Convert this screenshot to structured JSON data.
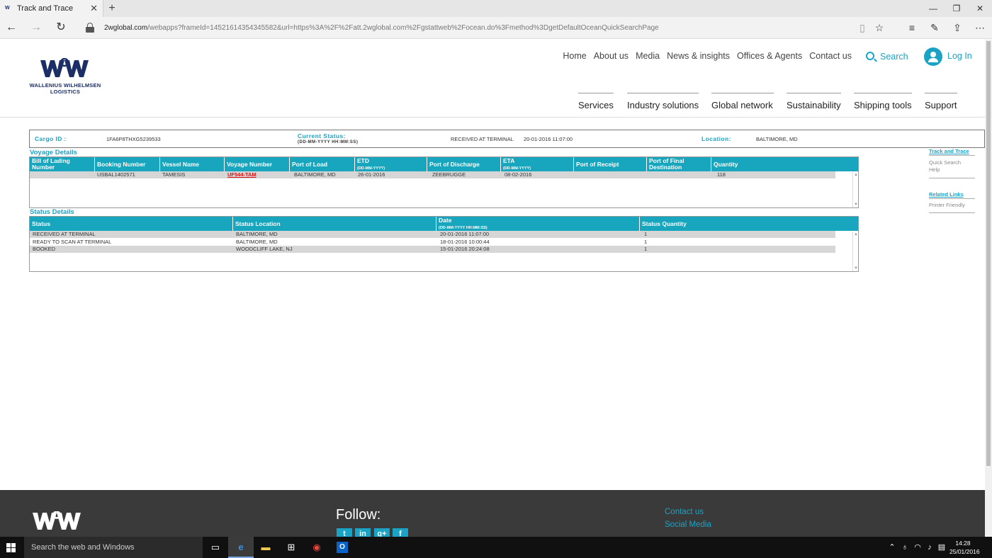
{
  "browser": {
    "tab_title": "Track and Trace",
    "new_tab": "+",
    "url_domain": "2wglobal.com",
    "url_path": "/webapps?frameId=14521614354345582&url=https%3A%2F%2Fatt.2wglobal.com%2Fgstattweb%2Focean.do%3Fmethod%3DgetDefaultOceanQuickSearchPage",
    "icons": [
      "back-icon",
      "forward-icon",
      "refresh-icon",
      "lock-icon",
      "reading-view-icon",
      "favorite-star-icon",
      "hub-icon",
      "web-note-icon",
      "share-icon",
      "more-icon"
    ]
  },
  "site": {
    "logo_text_line1": "WALLENIUS WILHELMSEN",
    "logo_text_line2": "LOGISTICS",
    "top_nav": [
      "Home",
      "About us",
      "Media",
      "News & insights",
      "Offices & Agents",
      "Contact us"
    ],
    "search_label": "Search",
    "login_label": "Log In",
    "main_nav": [
      "Services",
      "Industry solutions",
      "Global network",
      "Sustainability",
      "Shipping tools",
      "Support"
    ],
    "accent_color": "#1aa3c5",
    "brand_color": "#1b2f66"
  },
  "cargo": {
    "cargo_id_label": "Cargo ID :",
    "cargo_id_value": "1FA6P8THXG5239533",
    "current_status_label": "Current Status:",
    "current_status_format": "(DD-MM-YYYY HH:MM:SS)",
    "current_status_value": "RECEIVED AT TERMINAL",
    "current_status_date": "20-01-2016 11:07:00",
    "location_label": "Location:",
    "location_value": "BALTIMORE, MD"
  },
  "voyage": {
    "title": "Voyage Details",
    "headers": [
      {
        "line1": "Bill of Lading",
        "line2": "Number"
      },
      {
        "line1": "Booking Number"
      },
      {
        "line1": "Vessel Name"
      },
      {
        "line1": "Voyage Number"
      },
      {
        "line1": "Port of Load"
      },
      {
        "line1": "ETD",
        "sub": "(DD-MM-YYYY)"
      },
      {
        "line1": "Port of Discharge"
      },
      {
        "line1": "ETA",
        "sub": "(DD-MM-YYYY)"
      },
      {
        "line1": "Port of Receipt"
      },
      {
        "line1": "Port of Final",
        "line2": "Destination"
      },
      {
        "line1": "Quantity"
      }
    ],
    "rows": [
      [
        "",
        "USBAL1402571",
        "TAMESIS",
        "UF544-TAM",
        "BALTIMORE, MD",
        "26-01-2016",
        "ZEEBRUGGE",
        "08-02-2016",
        "",
        "",
        "118"
      ]
    ]
  },
  "status": {
    "title": "Status Details",
    "headers": [
      {
        "line1": "Status"
      },
      {
        "line1": "Status Location"
      },
      {
        "line1": "Date",
        "sub": "(DD-MM-YYYY HH:MM:SS)"
      },
      {
        "line1": "Status Quantity"
      }
    ],
    "rows": [
      [
        "RECEIVED AT TERMINAL",
        "BALTIMORE, MD",
        "20-01-2016 11:07:00",
        "1"
      ],
      [
        "READY TO SCAN AT TERMINAL",
        "BALTIMORE, MD",
        "18-01-2016 10:00:44",
        "1"
      ],
      [
        "BOOKED",
        "WOODCLIFF LAKE, NJ",
        "15-01-2016 20:24:08",
        "1"
      ]
    ]
  },
  "side_links": {
    "track_head": "Track and Trace",
    "quick_search": "Quick Search",
    "help": "Help",
    "related_head": "Related Links",
    "printer_friendly": "Printer Friendly"
  },
  "footer": {
    "follow": "Follow:",
    "links": [
      "Contact us",
      "Social Media"
    ],
    "social": [
      "twitter",
      "linkedin",
      "google-plus",
      "facebook"
    ],
    "social_glyphs": [
      "t",
      "in",
      "g+",
      "f"
    ]
  },
  "taskbar": {
    "search_placeholder": "Search the web and Windows",
    "time": "14:28",
    "date": "25/01/2016"
  }
}
